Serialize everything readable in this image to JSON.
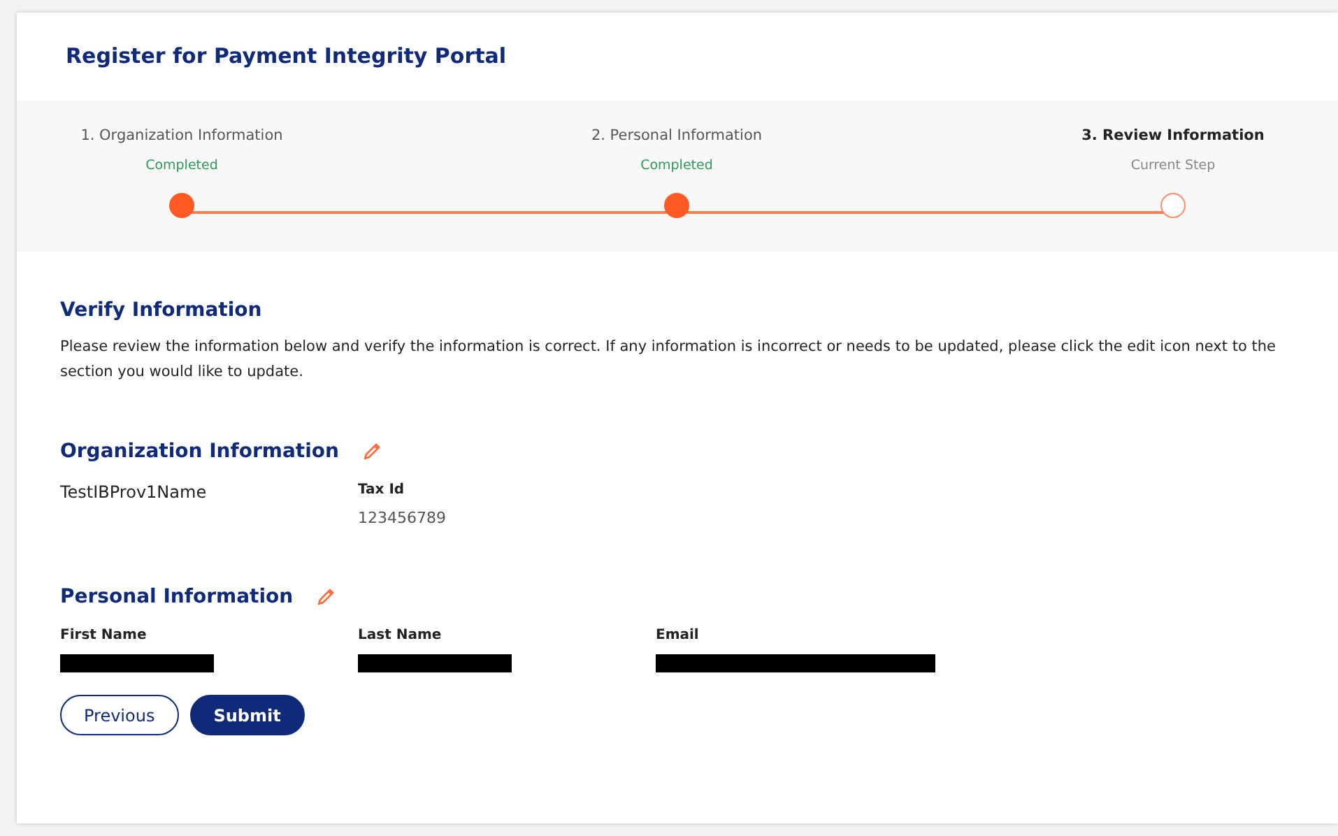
{
  "title": "Register for Payment Integrity Portal",
  "steps": [
    {
      "label": "1. Organization Information",
      "completed": true,
      "caption": "Completed"
    },
    {
      "label": "2. Personal Information",
      "completed": true,
      "caption": "Completed"
    },
    {
      "label": "3. Review Information",
      "completed": false,
      "caption": "Current Step"
    }
  ],
  "verify": {
    "heading": "Verify Information",
    "text": "Please review the information below and verify the information is correct. If any information is incorrect or needs to be updated, please click the edit icon next to the section you would like to update."
  },
  "sections": [
    {
      "heading": "Organization Information",
      "fields": [
        {
          "value": "TestIBProv1Name",
          "redacted": false
        },
        {
          "label": "Tax Id",
          "value": "123456789",
          "redacted": false
        }
      ]
    },
    {
      "heading": "Personal Information",
      "fields": [
        {
          "label": "First Name",
          "redacted": true
        },
        {
          "label": "Last Name",
          "redacted": true
        },
        {
          "label": "Email",
          "redacted": true
        }
      ]
    }
  ],
  "buttons": [
    {
      "label": "Previous",
      "kind": "secondary"
    },
    {
      "label": "Submit",
      "kind": "primary"
    }
  ]
}
